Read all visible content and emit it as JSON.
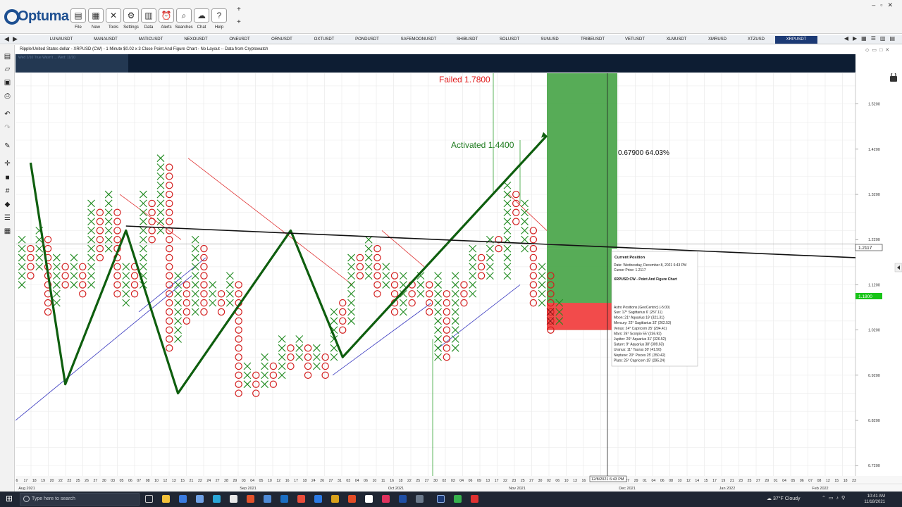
{
  "app": {
    "brand": "Optuma",
    "window_controls": [
      "–",
      "▫",
      "✕"
    ],
    "new_tab": "+"
  },
  "toolbar": [
    {
      "label": "File",
      "icon": "folder-icon",
      "glyph": "▤"
    },
    {
      "label": "New",
      "icon": "new-chart-icon",
      "glyph": "▦"
    },
    {
      "label": "Tools",
      "icon": "tools-icon",
      "glyph": "✕"
    },
    {
      "label": "Settings",
      "icon": "gear-icon",
      "glyph": "⚙"
    },
    {
      "label": "Data",
      "icon": "data-icon",
      "glyph": "▥"
    },
    {
      "label": "Alerts",
      "icon": "alarm-clock-icon",
      "glyph": "⏰"
    },
    {
      "label": "Searches",
      "icon": "search-icon",
      "glyph": "⌕"
    },
    {
      "label": "Chat",
      "icon": "chat-bubble-icon",
      "glyph": "☁"
    },
    {
      "label": "Help",
      "icon": "help-icon",
      "glyph": "?"
    }
  ],
  "tabs": [
    "LUNAUSDT",
    "MANAUSDT",
    "MATICUSDT",
    "NEXOUSDT",
    "ONEUSDT",
    "ORNUSDT",
    "OXTUSDT",
    "PONDUSDT",
    "SAFEMOONUSDT",
    "SHIBUSDT",
    "SOLUSDT",
    "SUNUSD",
    "TRIBEUSDT",
    "VETUSDT",
    "XLMUSDT",
    "XMRUSD",
    "XTZUSD",
    "XRPUSDT"
  ],
  "active_tab": "XRPUSDT",
  "chart": {
    "title": "Ripple/United States dollar - XRPUSD (CW) - 1 Minute $0.02 x 3 Close Point And Figure Chart - No Layout -- Data from Cryptowatch",
    "strip_text": "Wed 2/10  True Wasn't ... Wed: 11/10",
    "failed_label": "Failed 1.7800",
    "activated_label": "Activated 1.4400",
    "measure_label": "0.67900   64.03%",
    "cursor_price_tag": "1.2117",
    "green_price_tag": "1.1800",
    "cursor_date_tag": "12/8/2021 6:43 PM"
  },
  "tooltip": {
    "heading": "Current Position",
    "date": "Date: Wednesday, December 8, 2021 6:43 PM",
    "cursor_price": "Cursor Price: 1.2117",
    "series": "XRPUSD:CW - Point And Figure Chart",
    "astro_heading": "Astro Positions (GeoCentric) (-5:00)",
    "astro": [
      "Sun: 17° Sagittarius 6' (257.11)",
      "Moon: 21° Aquarius 19' (321.31)",
      "Mercury: 22° Sagittarius 32' (262.53)",
      "Venus: 24° Capricorn 25' (294.41)",
      "Mars: 26° Scorpio 55' (236.92)",
      "Jupiter: 26° Aquarius 31' (326.52)",
      "Saturn: 9° Aquarius 38' (309.63)",
      "Uranus: 11° Taurus 30' (41.50)",
      "Neptune: 20° Pisces 25' (350.42)",
      "Pluto: 25° Capricorn 15' (295.24)"
    ]
  },
  "chart_data": {
    "type": "scatter",
    "subtype": "point-and-figure",
    "box_size": 0.02,
    "reversal": 3,
    "y_axis_labels": [
      "1.5200",
      "1.4200",
      "1.3200",
      "1.2200",
      "1.1200",
      "1.0200",
      "0.9200",
      "0.8200",
      "0.7200"
    ],
    "y_axis_values": [
      1.52,
      1.42,
      1.32,
      1.22,
      1.12,
      1.02,
      0.92,
      0.82,
      0.72
    ],
    "ylim": [
      0.697,
      1.588
    ],
    "columns": [
      {
        "type": "X",
        "low": 1.12,
        "high": 1.22
      },
      {
        "type": "O",
        "low": 1.14,
        "high": 1.2
      },
      {
        "type": "X",
        "low": 1.16,
        "high": 1.24
      },
      {
        "type": "O",
        "low": 1.06,
        "high": 1.22
      },
      {
        "type": "X",
        "low": 1.08,
        "high": 1.18
      },
      {
        "type": "O",
        "low": 1.12,
        "high": 1.16
      },
      {
        "type": "X",
        "low": 1.12,
        "high": 1.18
      },
      {
        "type": "O",
        "low": 1.1,
        "high": 1.16
      },
      {
        "type": "X",
        "low": 1.12,
        "high": 1.3
      },
      {
        "type": "O",
        "low": 1.18,
        "high": 1.28
      },
      {
        "type": "X",
        "low": 1.2,
        "high": 1.32
      },
      {
        "type": "O",
        "low": 1.1,
        "high": 1.28
      },
      {
        "type": "X",
        "low": 1.08,
        "high": 1.16
      },
      {
        "type": "O",
        "low": 1.1,
        "high": 1.16
      },
      {
        "type": "X",
        "low": 1.12,
        "high": 1.32
      },
      {
        "type": "O",
        "low": 1.22,
        "high": 1.3
      },
      {
        "type": "X",
        "low": 1.24,
        "high": 1.4
      },
      {
        "type": "O",
        "low": 0.98,
        "high": 1.38
      },
      {
        "type": "X",
        "low": 1.0,
        "high": 1.14
      },
      {
        "type": "O",
        "low": 1.04,
        "high": 1.12
      },
      {
        "type": "X",
        "low": 1.06,
        "high": 1.22
      },
      {
        "type": "O",
        "low": 1.06,
        "high": 1.2
      },
      {
        "type": "X",
        "low": 1.08,
        "high": 1.12
      },
      {
        "type": "O",
        "low": 1.06,
        "high": 1.1
      },
      {
        "type": "X",
        "low": 1.08,
        "high": 1.14
      },
      {
        "type": "O",
        "low": 0.88,
        "high": 1.12
      },
      {
        "type": "X",
        "low": 0.9,
        "high": 0.94
      },
      {
        "type": "O",
        "low": 0.88,
        "high": 0.92
      },
      {
        "type": "X",
        "low": 0.9,
        "high": 0.96
      },
      {
        "type": "O",
        "low": 0.9,
        "high": 0.94
      },
      {
        "type": "X",
        "low": 0.92,
        "high": 1.0
      },
      {
        "type": "O",
        "low": 0.94,
        "high": 0.98
      },
      {
        "type": "X",
        "low": 0.96,
        "high": 1.0
      },
      {
        "type": "O",
        "low": 0.92,
        "high": 0.98
      },
      {
        "type": "X",
        "low": 0.94,
        "high": 0.98
      },
      {
        "type": "O",
        "low": 0.92,
        "high": 0.96
      },
      {
        "type": "X",
        "low": 0.96,
        "high": 1.06
      },
      {
        "type": "O",
        "low": 1.02,
        "high": 1.08
      },
      {
        "type": "X",
        "low": 1.04,
        "high": 1.18
      },
      {
        "type": "O",
        "low": 1.14,
        "high": 1.18
      },
      {
        "type": "X",
        "low": 1.14,
        "high": 1.22
      },
      {
        "type": "O",
        "low": 1.1,
        "high": 1.2
      },
      {
        "type": "X",
        "low": 1.12,
        "high": 1.16
      },
      {
        "type": "O",
        "low": 1.06,
        "high": 1.14
      },
      {
        "type": "X",
        "low": 1.06,
        "high": 1.14
      },
      {
        "type": "O",
        "low": 1.08,
        "high": 1.12
      },
      {
        "type": "X",
        "low": 1.1,
        "high": 1.14
      },
      {
        "type": "O",
        "low": 1.06,
        "high": 1.12
      },
      {
        "type": "X",
        "low": 0.96,
        "high": 1.14
      },
      {
        "type": "O",
        "low": 0.96,
        "high": 1.1
      },
      {
        "type": "X",
        "low": 0.98,
        "high": 1.14
      },
      {
        "type": "O",
        "low": 1.08,
        "high": 1.12
      },
      {
        "type": "X",
        "low": 1.1,
        "high": 1.2
      },
      {
        "type": "O",
        "low": 1.14,
        "high": 1.18
      },
      {
        "type": "X",
        "low": 1.14,
        "high": 1.22
      },
      {
        "type": "O",
        "low": 1.2,
        "high": 1.22
      },
      {
        "type": "X",
        "low": 1.14,
        "high": 1.34
      },
      {
        "type": "O",
        "low": 1.26,
        "high": 1.32
      },
      {
        "type": "X",
        "low": 1.2,
        "high": 1.3
      },
      {
        "type": "O",
        "low": 1.08,
        "high": 1.24
      },
      {
        "type": "X",
        "low": 1.08,
        "high": 1.16
      },
      {
        "type": "O",
        "low": 1.02,
        "high": 1.14
      },
      {
        "type": "X",
        "low": 1.04,
        "high": 1.08
      }
    ],
    "x_tick_labels": [
      "6",
      "17",
      "18",
      "19",
      "20",
      "22",
      "23",
      "25",
      "26",
      "27",
      "30",
      "03",
      "05",
      "06",
      "07",
      "08",
      "10",
      "12",
      "13",
      "15",
      "21",
      "22",
      "24",
      "27",
      "28",
      "29",
      "03",
      "04",
      "05",
      "10",
      "12",
      "16",
      "17",
      "18",
      "24",
      "26",
      "27",
      "31",
      "03",
      "04",
      "06",
      "10",
      "11",
      "16",
      "18",
      "22",
      "25",
      "27",
      "30",
      "02",
      "03",
      "04",
      "06",
      "09",
      "13",
      "17",
      "22",
      "23",
      "25",
      "27",
      "30",
      "02",
      "06",
      "10",
      "13",
      "16",
      "18",
      "20",
      "23",
      "25",
      "27",
      "29",
      "01",
      "04",
      "06",
      "08",
      "10",
      "12",
      "14",
      "15",
      "17",
      "19",
      "21",
      "23",
      "25",
      "27",
      "29",
      "01",
      "04",
      "05",
      "06",
      "07",
      "08",
      "12",
      "15",
      "18",
      "23"
    ],
    "month_labels": [
      "Aug 2021",
      "Sep 2021",
      "Oct 2021",
      "Nov 2021",
      "Dec 2021",
      "Jan 2022",
      "Feb 2022"
    ],
    "trendline_path": [
      [
        1.39,
        1
      ],
      [
        0.9,
        5
      ],
      [
        1.24,
        12
      ],
      [
        0.88,
        18
      ],
      [
        1.24,
        31
      ],
      [
        0.96,
        37
      ],
      [
        1.45,
        57
      ]
    ],
    "resistance_line": {
      "start": 1.25,
      "end": 1.18
    },
    "zones": {
      "target_high": 1.59,
      "entry": 1.2,
      "stop": 1.02
    }
  }
}
